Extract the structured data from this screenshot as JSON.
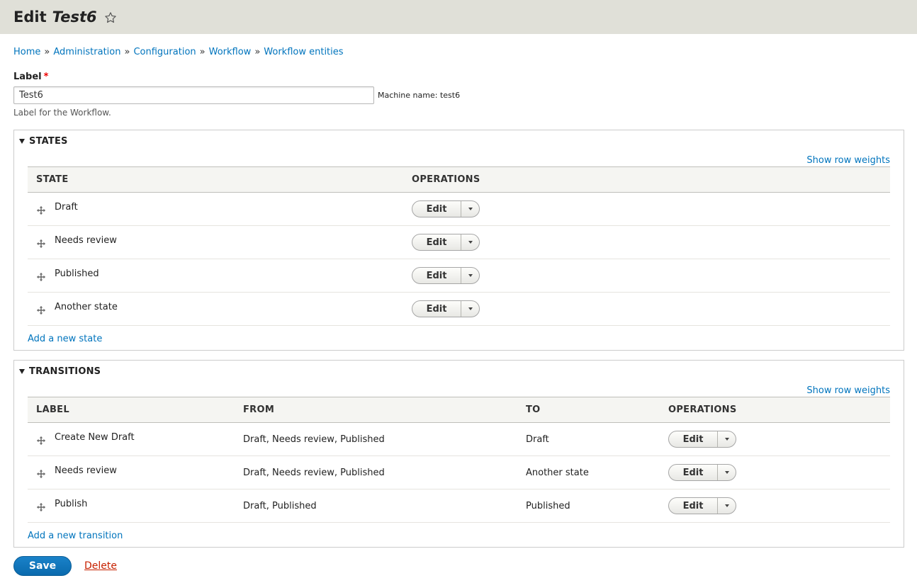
{
  "header": {
    "title_prefix": "Edit",
    "title_name": "Test6"
  },
  "breadcrumb": [
    {
      "label": "Home"
    },
    {
      "label": "Administration"
    },
    {
      "label": "Configuration"
    },
    {
      "label": "Workflow"
    },
    {
      "label": "Workflow entities"
    }
  ],
  "breadcrumb_separator": "»",
  "label_field": {
    "label": "Label",
    "required_marker": "*",
    "value": "Test6",
    "machine_name": "Machine name: test6",
    "description": "Label for the Workflow."
  },
  "states": {
    "legend": "STATES",
    "show_row_weights": "Show row weights",
    "columns": [
      "STATE",
      "OPERATIONS"
    ],
    "rows": [
      {
        "label": "Draft",
        "op": "Edit"
      },
      {
        "label": "Needs review",
        "op": "Edit"
      },
      {
        "label": "Published",
        "op": "Edit"
      },
      {
        "label": "Another state",
        "op": "Edit"
      }
    ],
    "add_link": "Add a new state"
  },
  "transitions": {
    "legend": "TRANSITIONS",
    "show_row_weights": "Show row weights",
    "columns": [
      "LABEL",
      "FROM",
      "TO",
      "OPERATIONS"
    ],
    "rows": [
      {
        "label": "Create New Draft",
        "from": "Draft, Needs review, Published",
        "to": "Draft",
        "op": "Edit"
      },
      {
        "label": "Needs review",
        "from": "Draft, Needs review, Published",
        "to": "Another state",
        "op": "Edit"
      },
      {
        "label": "Publish",
        "from": "Draft, Published",
        "to": "Published",
        "op": "Edit"
      }
    ],
    "add_link": "Add a new transition"
  },
  "actions": {
    "save": "Save",
    "delete": "Delete"
  },
  "colors": {
    "link": "#0074bd",
    "primary": "#0a6aad",
    "danger": "#c72100",
    "header_bg": "#e0e0d8"
  },
  "icons": {
    "star": "star-icon",
    "drag": "drag-handle-icon",
    "collapse": "triangle-down-icon",
    "dropdown": "caret-down-icon"
  }
}
